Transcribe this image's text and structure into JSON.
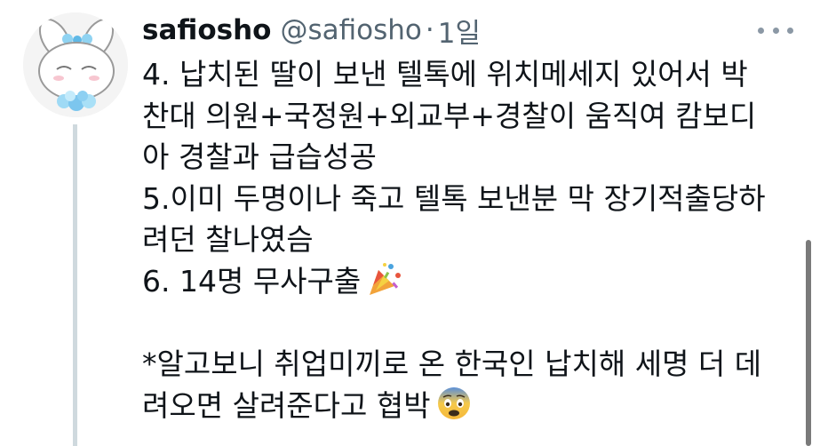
{
  "tweet": {
    "author": {
      "display_name": "safiosho",
      "handle": "@safiosho",
      "separator": "·",
      "time": "1일"
    },
    "more_icon": "ellipsis-horizontal-icon",
    "lines": [
      "4. 납치된 딸이 보낸 텔톡에 위치메세지 있어서 박",
      "찬대 의원+국정원+외교부+경찰이 움직여 캄보디",
      "아 경찰과 급습성공",
      "5.이미 두명이나 죽고 텔톡 보낸분 막 장기적출당하",
      "려던 찰나였슴",
      "6. 14명 무사구출",
      "",
      "*알고보니 취업미끼로 온 한국인 납치해 세명 더 데",
      "려오면 살려준다고 협박"
    ],
    "emojis": {
      "line6": "party-popper-emoji",
      "line9": "fearful-face-emoji"
    }
  },
  "colors": {
    "text": "#0f1419",
    "secondary": "#536471",
    "thread_line": "#cfd9de",
    "scrollbar": "#7a7a7a"
  }
}
